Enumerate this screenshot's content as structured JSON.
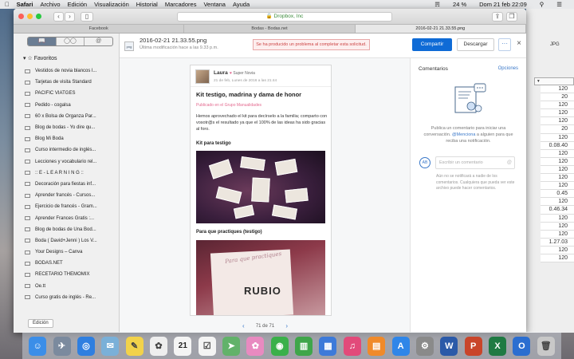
{
  "menubar": {
    "apple": "",
    "items": [
      "Safari",
      "Archivo",
      "Edición",
      "Visualización",
      "Historial",
      "Marcadores",
      "Ventana",
      "Ayuda"
    ],
    "battery": "24 %",
    "clock": "Dom 21 feb  22:09"
  },
  "browser": {
    "url": "Dropbox, Inc",
    "tabs": [
      {
        "label": "Facebook"
      },
      {
        "label": "Bodas - Bodas.net"
      },
      {
        "label": "2016-02-21 21.33.55.png"
      }
    ]
  },
  "sidebar": {
    "section_title": "Favoritos",
    "items": [
      {
        "label": "Vestidos de novia blancos l..."
      },
      {
        "label": "Tarjetas de visita Standard"
      },
      {
        "label": "PACIFIC VIATGES"
      },
      {
        "label": "Pedido - cogalsa"
      },
      {
        "label": "60 x Bolsa de Organza Par..."
      },
      {
        "label": "Blog de bodas - Yo dire qu..."
      },
      {
        "label": "Blog Mi Boda"
      },
      {
        "label": "Curso intermedio de inglés..."
      },
      {
        "label": "Lecciones y vocabulario rel..."
      },
      {
        "label": ":: E - L E A R N I N G ::"
      },
      {
        "label": "Decoración para fiestas inf..."
      },
      {
        "label": "Aprender francés - Cursos..."
      },
      {
        "label": "Ejercicio de francés - Gram..."
      },
      {
        "label": "Aprender Frances Gratis :..."
      },
      {
        "label": "Blog de bodas de Una Bod..."
      },
      {
        "label": "Boda ( David+Jenni ) Los V..."
      },
      {
        "label": "Your Designs – Canva"
      },
      {
        "label": "BODAS.NET"
      },
      {
        "label": "RECETARIO THEMOMIX"
      },
      {
        "label": "Oe.tt"
      },
      {
        "label": "Curso gratis de inglés - Re..."
      }
    ],
    "edit_button": "Edición"
  },
  "file": {
    "name": "2016-02-21 21.33.55.png",
    "modified": "Última modificación hace a las 9.33 p.m.",
    "error": "Se ha producido un problema al completar esta solicitud.",
    "share": "Compartir",
    "download": "Descargar",
    "more": "···",
    "close": "×"
  },
  "doc": {
    "author": "Laura",
    "badge": "Super Novia",
    "time": "21 de feb, Lunes de 2016 a las 21:44",
    "title": "Kit testigo, madrina y dama de honor",
    "subtitle": "Publicado en el Grupo Manualidades",
    "body": "Hemos aprovechado el kit para decírselo a la familia; comparto con vosotr@s el resultado ya que el 100% de las ideas ha sido gracias al foro.",
    "heading1": "Kit para testigo",
    "heading2": "Para que practiques (testigo)",
    "image2_script": "Para que practiques",
    "image2_text": "RUBIO"
  },
  "pager": {
    "prev": "‹",
    "label": "71 de 71",
    "next": "›"
  },
  "comments": {
    "title": "Comentarios",
    "options": "Opciones",
    "info_pre": "Publica un comentario para iniciar una conversación. ",
    "info_link": "@Menciona",
    "info_post": " a alguien para que reciba una notificación.",
    "avatar": "AB",
    "placeholder": "Escribir un comentario",
    "mention_icon": "@",
    "note": "Aún no se notificará a nadie de los comentarios. Cualquiera que pueda ver este archivo puede hacer comentarios."
  },
  "background_window": {
    "title": "JPG",
    "values": [
      "120",
      "20",
      "120",
      "120",
      "120",
      "20",
      "120",
      "0.08.40",
      "120",
      "120",
      "120",
      "120",
      "120",
      "0.45",
      "120",
      "0.46.34",
      "120",
      "120",
      "120",
      "1.27.03",
      "120",
      "120"
    ]
  },
  "dock": {
    "calendar_day": "21",
    "items": [
      "finder-icon",
      "launchpad-icon",
      "safari-icon",
      "mail-icon",
      "notes-icon",
      "photos-icon",
      "calendar-icon",
      "reminders-icon",
      "maps-icon",
      "photos-app-icon",
      "facetime-icon",
      "numbers-icon",
      "keynote-icon",
      "itunes-icon",
      "ibooks-icon",
      "appstore-icon",
      "system-prefs-icon",
      "word-icon",
      "powerpoint-icon",
      "excel-icon",
      "outlook-icon",
      "trash-icon"
    ]
  }
}
